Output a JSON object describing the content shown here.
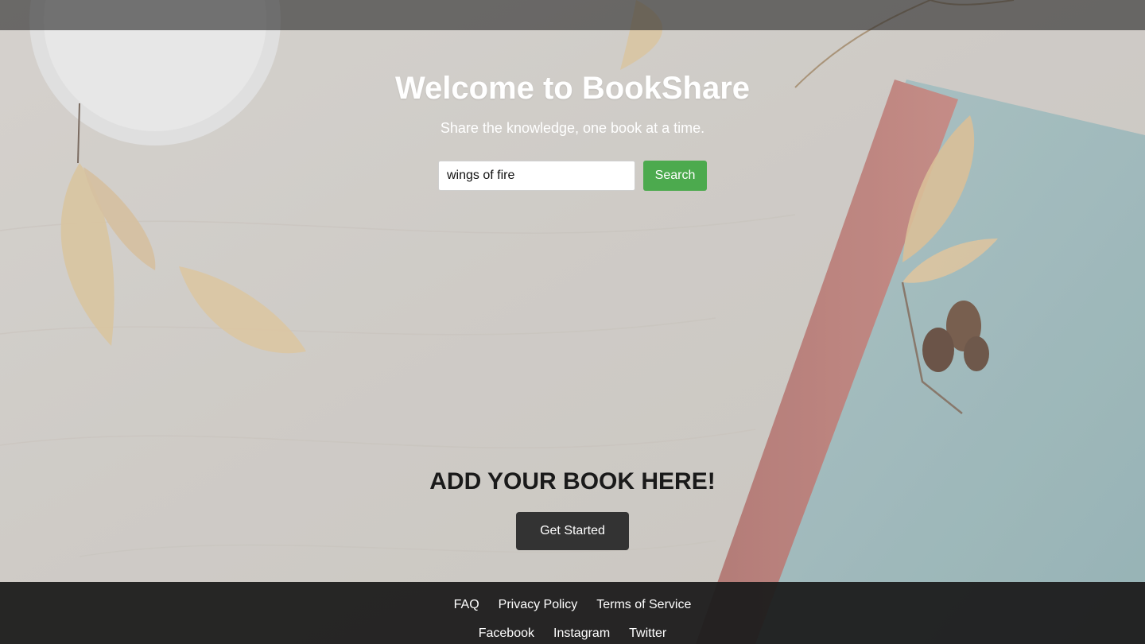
{
  "hero": {
    "title": "Welcome to BookShare",
    "subtitle": "Share the knowledge, one book at a time."
  },
  "search": {
    "value": "wings of fire",
    "button_label": "Search"
  },
  "cta": {
    "heading": "ADD YOUR BOOK HERE!",
    "button_label": "Get Started"
  },
  "footer": {
    "links": [
      "FAQ",
      "Privacy Policy",
      "Terms of Service"
    ],
    "social": [
      "Facebook",
      "Instagram",
      "Twitter"
    ]
  },
  "colors": {
    "search_button": "#4caa4e",
    "cta_button": "#333333",
    "footer_bg": "#1c1c1c"
  }
}
